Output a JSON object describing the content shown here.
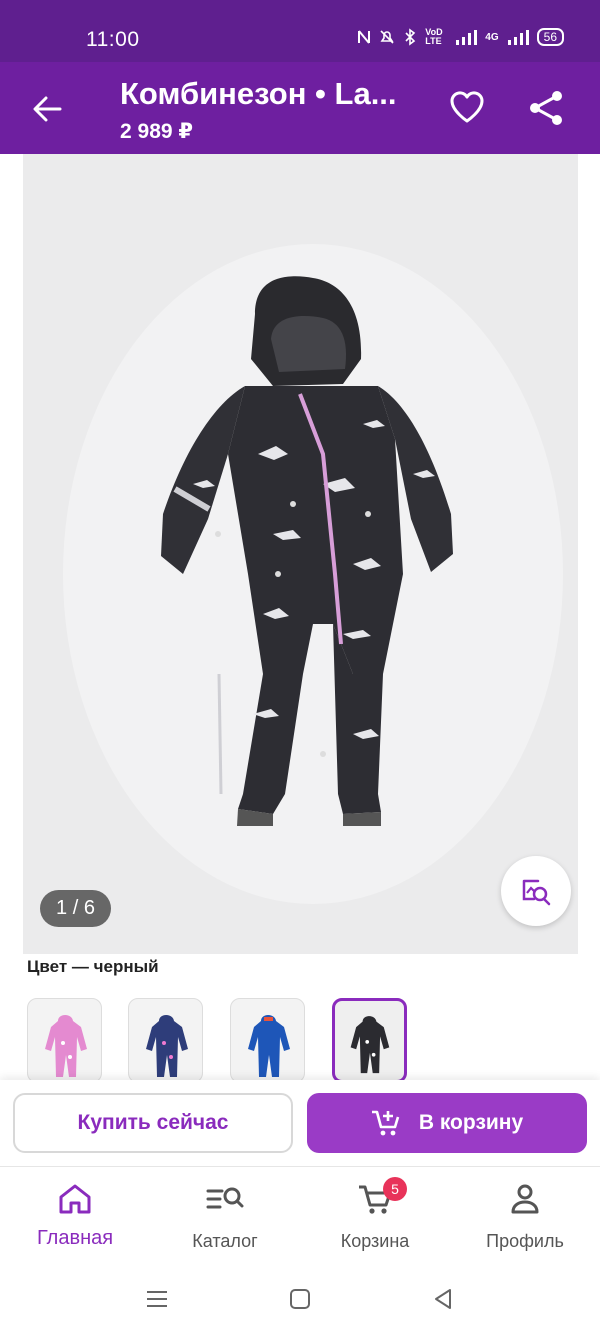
{
  "status_bar": {
    "time": "11:00",
    "net_label": "VoD LTE",
    "signal_label": "4G",
    "battery": "56"
  },
  "header": {
    "title": "Комбинезон • La...",
    "price": "2 989 ₽"
  },
  "gallery": {
    "counter": "1 / 6"
  },
  "color": {
    "label": "Цвет — черный",
    "swatches": [
      "pink",
      "navy",
      "blue",
      "black"
    ],
    "selected_index": 3
  },
  "actions": {
    "buy_now": "Купить сейчас",
    "add_to_cart": "В корзину"
  },
  "nav": {
    "items": [
      {
        "label": "Главная",
        "icon": "home-icon",
        "active": true
      },
      {
        "label": "Каталог",
        "icon": "catalog-search-icon",
        "active": false
      },
      {
        "label": "Корзина",
        "icon": "cart-icon",
        "active": false,
        "badge": "5"
      },
      {
        "label": "Профиль",
        "icon": "profile-icon",
        "active": false
      }
    ]
  },
  "colors": {
    "status_bg": "#5f1f8f",
    "app_bar_bg": "#6e1fa0",
    "accent": "#8a2bbd",
    "cart_button": "#9a3bc6",
    "badge": "#e8335a"
  }
}
